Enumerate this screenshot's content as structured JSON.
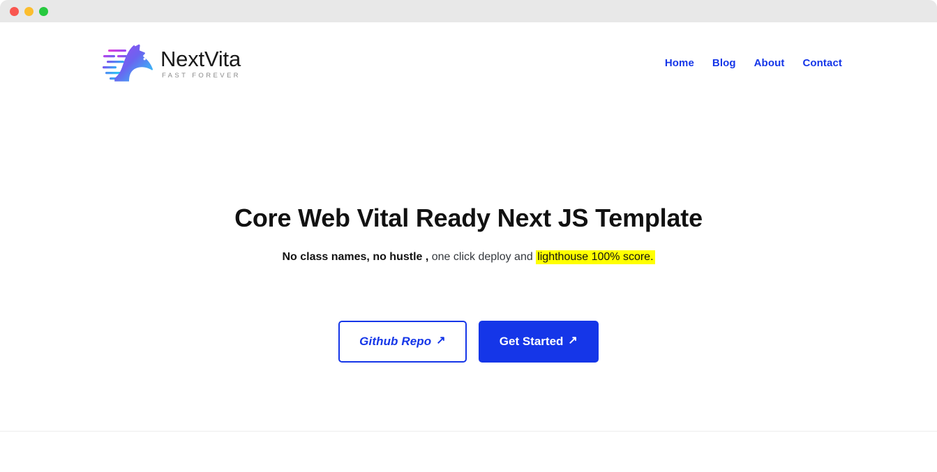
{
  "window": {
    "controls": [
      {
        "name": "close",
        "color": "#f9564f"
      },
      {
        "name": "minimize",
        "color": "#fbbd2e"
      },
      {
        "name": "maximize",
        "color": "#27c93f"
      }
    ]
  },
  "brand": {
    "name": "NextVita",
    "tagline": "FAST FOREVER",
    "logo_icon": "horse-head-speed-icon",
    "gradient_from": "#a14bf5",
    "gradient_to": "#28d4f5"
  },
  "nav": {
    "items": [
      {
        "label": "Home",
        "name": "home"
      },
      {
        "label": "Blog",
        "name": "blog"
      },
      {
        "label": "About",
        "name": "about"
      },
      {
        "label": "Contact",
        "name": "contact"
      }
    ],
    "link_color": "#1536e8"
  },
  "hero": {
    "title": "Core Web Vital Ready Next JS Template",
    "subtitle": {
      "strong": "No class names, no hustle ,",
      "normal": " one click deploy and ",
      "highlight": "lighthouse 100% score.",
      "highlight_color": "#ffff00"
    },
    "buttons": {
      "secondary": {
        "label": "Github Repo",
        "arrow": "↗",
        "icon": "arrow-up-right-icon"
      },
      "primary": {
        "label": "Get Started",
        "arrow": "↗",
        "icon": "arrow-up-right-icon"
      }
    }
  },
  "theme": {
    "accent": "#1536e8",
    "titlebar": "#e8e8e8",
    "divider": "#ededed",
    "text": "#111111"
  }
}
